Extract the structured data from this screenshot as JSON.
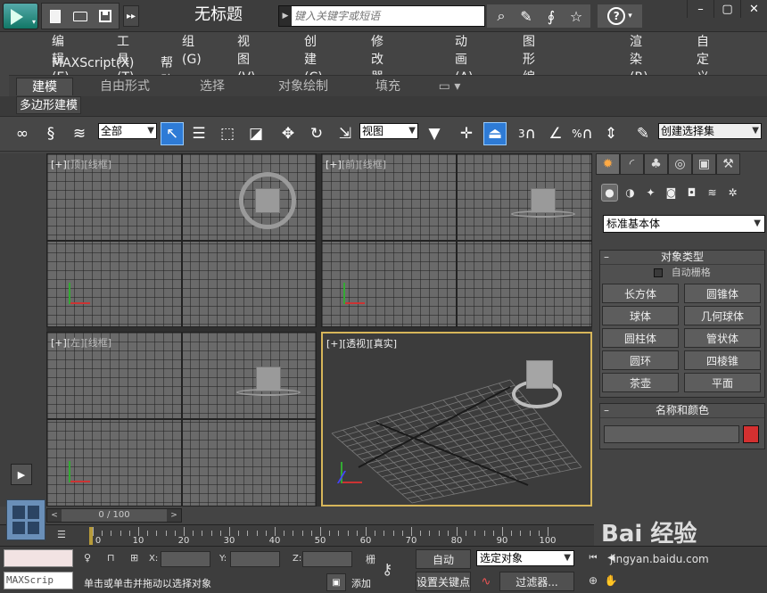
{
  "window": {
    "title": "无标题",
    "search_placeholder": "键入关键字或短语",
    "minimize": "–",
    "restore": "▢",
    "close": "✕"
  },
  "menu": {
    "row1": [
      "编辑(E)",
      "工具(T)",
      "组(G)",
      "视图(V)",
      "创建(C)",
      "修改器(M)",
      "动画(A)",
      "图形编辑器(D)",
      "渲染(R)",
      "自定义(U)"
    ],
    "row2": [
      "MAXScript(X)",
      "帮助(H)"
    ]
  },
  "ribbon": {
    "tabs": [
      "建模",
      "自由形式",
      "选择",
      "对象绘制",
      "填充"
    ],
    "active_tab": "建模",
    "panel_label": "多边形建模"
  },
  "toolbar": {
    "selection_filter": "全部",
    "reference_coord": "视图",
    "named_selection": "创建选择集",
    "snap_3": "3",
    "snap_percent": "%"
  },
  "viewports": {
    "top": {
      "bracket": "[+]",
      "view": "[顶]",
      "shade": "[线框]"
    },
    "front": {
      "bracket": "[+]",
      "view": "[前]",
      "shade": "[线框]"
    },
    "left": {
      "bracket": "[+]",
      "view": "[左]",
      "shade": "[线框]"
    },
    "persp": {
      "bracket": "[+]",
      "view": "[透视]",
      "shade": "[真实]"
    }
  },
  "command_panel": {
    "category": "标准基本体",
    "object_type_header": "对象类型",
    "autogrid_label": "自动栅格",
    "objects": [
      "长方体",
      "圆锥体",
      "球体",
      "几何球体",
      "圆柱体",
      "管状体",
      "圆环",
      "四棱锥",
      "茶壶",
      "平面"
    ],
    "name_color_header": "名称和颜色",
    "color": "#d43030"
  },
  "timeline": {
    "readout": "0 / 100",
    "labels": [
      "0",
      "10",
      "20",
      "30",
      "40",
      "50",
      "60",
      "70",
      "80",
      "90",
      "100"
    ]
  },
  "status": {
    "maxscript_label": "MAXScrip",
    "x_label": "X:",
    "y_label": "Y:",
    "z_label": "Z:",
    "grid_label": "栅",
    "message": "单击或单击并拖动以选择对象",
    "add_label": "添加",
    "auto_key": "自动",
    "set_key": "设置关键点",
    "selected_set": "选定对象",
    "filters": "过滤器..."
  },
  "watermark": {
    "logo": "Bai 经验",
    "url": "jingyan.baidu.com"
  }
}
